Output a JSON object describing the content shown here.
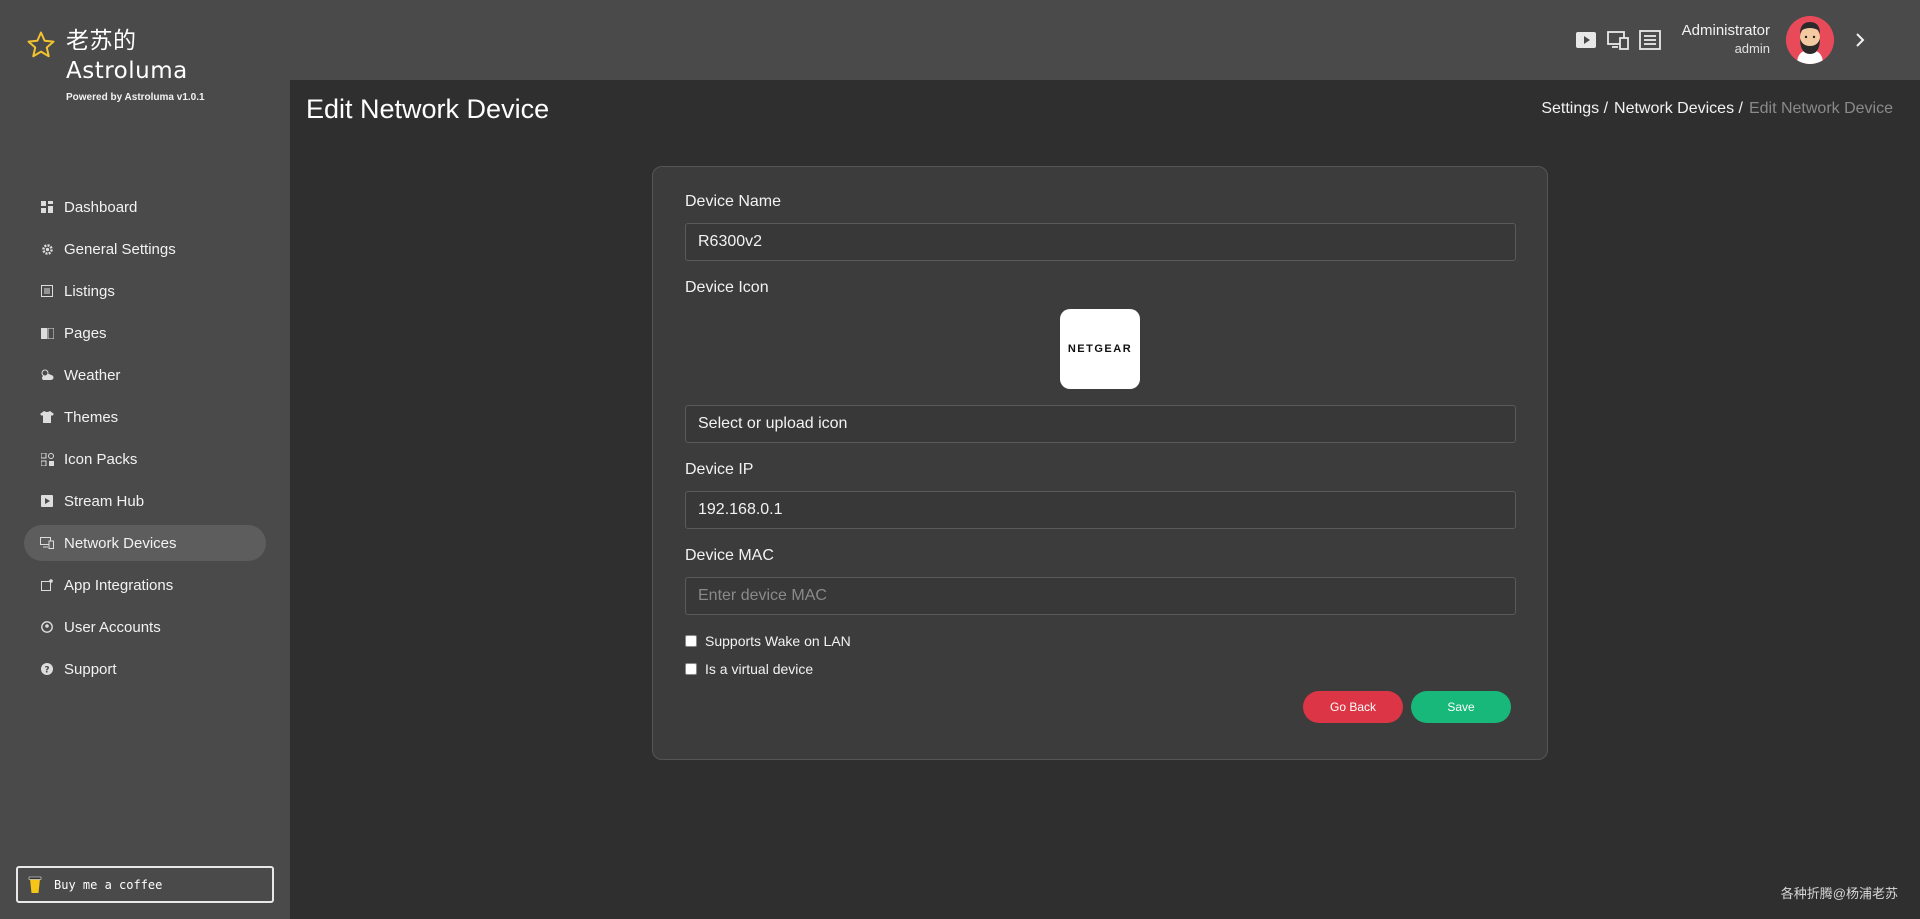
{
  "brand": {
    "title_line1": "老苏的",
    "title_line2": "Astroluma",
    "powered": "Powered by Astroluma v1.0.1",
    "accent": "#f2c230"
  },
  "nav": {
    "items": [
      {
        "label": "Dashboard",
        "icon": "grid-icon"
      },
      {
        "label": "General Settings",
        "icon": "gear-icon"
      },
      {
        "label": "Listings",
        "icon": "list-icon"
      },
      {
        "label": "Pages",
        "icon": "book-icon"
      },
      {
        "label": "Weather",
        "icon": "weather-icon"
      },
      {
        "label": "Themes",
        "icon": "shirt-icon"
      },
      {
        "label": "Icon Packs",
        "icon": "shapes-icon"
      },
      {
        "label": "Stream Hub",
        "icon": "play-icon"
      },
      {
        "label": "Network Devices",
        "icon": "network-icon",
        "active": true
      },
      {
        "label": "App Integrations",
        "icon": "integration-icon"
      },
      {
        "label": "User Accounts",
        "icon": "user-icon"
      },
      {
        "label": "Support",
        "icon": "help-icon"
      }
    ]
  },
  "coffee": {
    "label": "Buy me a coffee"
  },
  "user": {
    "name": "Administrator",
    "role": "admin"
  },
  "header": {
    "title": "Edit Network Device",
    "breadcrumb": {
      "settings": "Settings /",
      "network": "Network Devices /",
      "current": "Edit Network Device"
    }
  },
  "form": {
    "device_name_label": "Device Name",
    "device_name_value": "R6300v2",
    "device_icon_label": "Device Icon",
    "icon_preview_text": "NETGEAR",
    "select_icon_label": "Select or upload icon",
    "device_ip_label": "Device IP",
    "device_ip_value": "192.168.0.1",
    "device_mac_label": "Device MAC",
    "device_mac_placeholder": "Enter device MAC",
    "wol_label": "Supports Wake on LAN",
    "virtual_label": "Is a virtual device",
    "go_back_label": "Go Back",
    "save_label": "Save"
  },
  "watermark": "各种折腾@杨浦老苏"
}
